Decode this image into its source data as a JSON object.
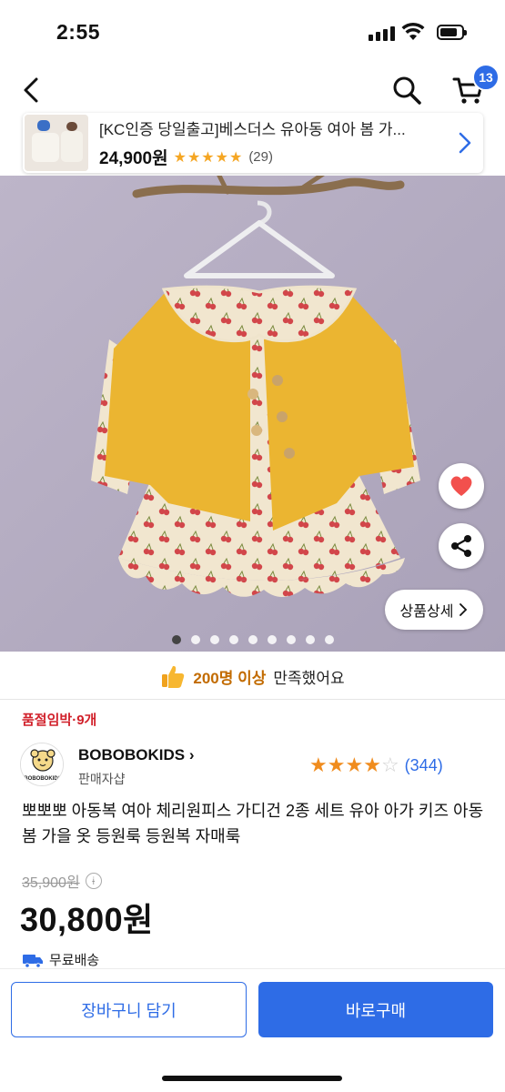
{
  "status_bar": {
    "time": "2:55"
  },
  "nav": {
    "cart_count": "13"
  },
  "mini_product": {
    "title": "[KC인증 당일출고]베스더스 유아동 여아 봄 가...",
    "price": "24,900원",
    "rating": 4.5,
    "stars": "★★★★★",
    "review_count": "(29)"
  },
  "gallery": {
    "detail_label": "상품상세",
    "image_count": 9,
    "active_index": 0
  },
  "satisfaction": {
    "highlight": "200명 이상",
    "text": "만족했어요"
  },
  "stock_notice": "품절임박·9개",
  "seller": {
    "name": "BOBOBOKIDS",
    "logo_text": "BOBOBOKIDS",
    "subtitle": "판매자샵",
    "rating": 4,
    "review_count": "(344)"
  },
  "product": {
    "title": "뽀뽀뽀 아동복 여아 체리원피스 가디건 2종 세트 유아 아가 키즈 아동 봄 가을 옷 등원룩 등원복 자매룩",
    "original_price": "35,900원",
    "info_glyph": "i",
    "price": "30,800원",
    "shipping": "무료배송"
  },
  "actions": {
    "cart_label": "장바구니 담기",
    "buy_label": "바로구매"
  },
  "colors": {
    "accent": "#2e6ce6",
    "stock_red": "#d1202a",
    "star_orange": "#f08c1e",
    "hero_bg": "#b9b1c4",
    "cardigan": "#ebb531",
    "dress": "#f1e6cf",
    "cherry": "#d2464a"
  }
}
